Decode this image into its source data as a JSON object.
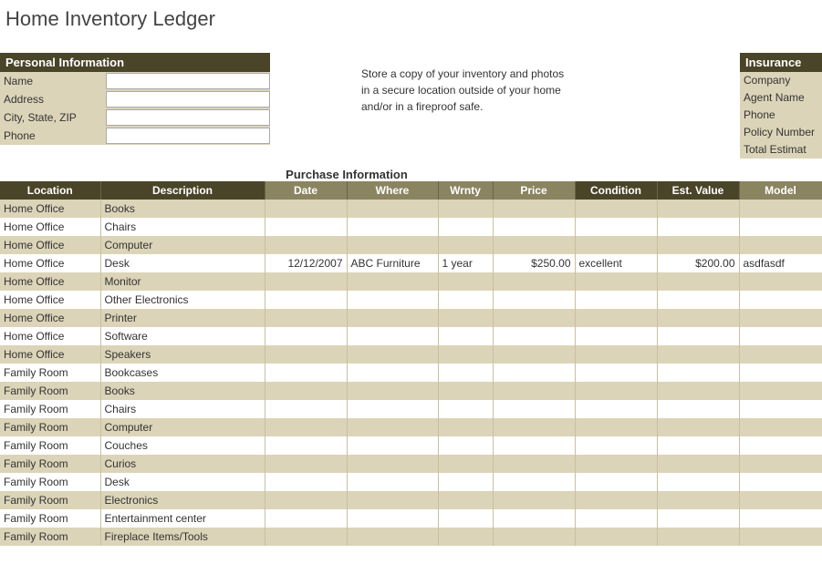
{
  "title": "Home Inventory Ledger",
  "personal": {
    "header": "Personal Information",
    "fields": [
      {
        "label": "Name",
        "value": ""
      },
      {
        "label": "Address",
        "value": ""
      },
      {
        "label": "City, State, ZIP",
        "value": ""
      },
      {
        "label": "Phone",
        "value": ""
      }
    ]
  },
  "note": {
    "line1": "Store a copy of your inventory and photos",
    "line2": "in a secure location outside of your home",
    "line3": "and/or in a fireproof safe."
  },
  "insurance": {
    "header": "Insurance",
    "fields": [
      "Company",
      "Agent Name",
      "Phone",
      "Policy Number",
      "Total Estimat"
    ]
  },
  "purchase_section_title": "Purchase Information",
  "columns": {
    "location": "Location",
    "description": "Description",
    "date": "Date",
    "where": "Where",
    "wrnty": "Wrnty",
    "price": "Price",
    "condition": "Condition",
    "est_value": "Est. Value",
    "model": "Model"
  },
  "rows": [
    {
      "location": "Home Office",
      "description": "Books",
      "date": "",
      "where": "",
      "wrnty": "",
      "price": "",
      "condition": "",
      "est_value": "",
      "model": ""
    },
    {
      "location": "Home Office",
      "description": "Chairs",
      "date": "",
      "where": "",
      "wrnty": "",
      "price": "",
      "condition": "",
      "est_value": "",
      "model": ""
    },
    {
      "location": "Home Office",
      "description": "Computer",
      "date": "",
      "where": "",
      "wrnty": "",
      "price": "",
      "condition": "",
      "est_value": "",
      "model": ""
    },
    {
      "location": "Home Office",
      "description": "Desk",
      "date": "12/12/2007",
      "where": "ABC Furniture",
      "wrnty": "1 year",
      "price": "$250.00",
      "condition": "excellent",
      "est_value": "$200.00",
      "model": "asdfasdf"
    },
    {
      "location": "Home Office",
      "description": "Monitor",
      "date": "",
      "where": "",
      "wrnty": "",
      "price": "",
      "condition": "",
      "est_value": "",
      "model": ""
    },
    {
      "location": "Home Office",
      "description": "Other Electronics",
      "date": "",
      "where": "",
      "wrnty": "",
      "price": "",
      "condition": "",
      "est_value": "",
      "model": ""
    },
    {
      "location": "Home Office",
      "description": "Printer",
      "date": "",
      "where": "",
      "wrnty": "",
      "price": "",
      "condition": "",
      "est_value": "",
      "model": ""
    },
    {
      "location": "Home Office",
      "description": "Software",
      "date": "",
      "where": "",
      "wrnty": "",
      "price": "",
      "condition": "",
      "est_value": "",
      "model": ""
    },
    {
      "location": "Home Office",
      "description": "Speakers",
      "date": "",
      "where": "",
      "wrnty": "",
      "price": "",
      "condition": "",
      "est_value": "",
      "model": ""
    },
    {
      "location": "Family Room",
      "description": "Bookcases",
      "date": "",
      "where": "",
      "wrnty": "",
      "price": "",
      "condition": "",
      "est_value": "",
      "model": ""
    },
    {
      "location": "Family Room",
      "description": "Books",
      "date": "",
      "where": "",
      "wrnty": "",
      "price": "",
      "condition": "",
      "est_value": "",
      "model": ""
    },
    {
      "location": "Family Room",
      "description": "Chairs",
      "date": "",
      "where": "",
      "wrnty": "",
      "price": "",
      "condition": "",
      "est_value": "",
      "model": ""
    },
    {
      "location": "Family Room",
      "description": "Computer",
      "date": "",
      "where": "",
      "wrnty": "",
      "price": "",
      "condition": "",
      "est_value": "",
      "model": ""
    },
    {
      "location": "Family Room",
      "description": "Couches",
      "date": "",
      "where": "",
      "wrnty": "",
      "price": "",
      "condition": "",
      "est_value": "",
      "model": ""
    },
    {
      "location": "Family Room",
      "description": "Curios",
      "date": "",
      "where": "",
      "wrnty": "",
      "price": "",
      "condition": "",
      "est_value": "",
      "model": ""
    },
    {
      "location": "Family Room",
      "description": "Desk",
      "date": "",
      "where": "",
      "wrnty": "",
      "price": "",
      "condition": "",
      "est_value": "",
      "model": ""
    },
    {
      "location": "Family Room",
      "description": "Electronics",
      "date": "",
      "where": "",
      "wrnty": "",
      "price": "",
      "condition": "",
      "est_value": "",
      "model": ""
    },
    {
      "location": "Family Room",
      "description": "Entertainment center",
      "date": "",
      "where": "",
      "wrnty": "",
      "price": "",
      "condition": "",
      "est_value": "",
      "model": ""
    },
    {
      "location": "Family Room",
      "description": "Fireplace Items/Tools",
      "date": "",
      "where": "",
      "wrnty": "",
      "price": "",
      "condition": "",
      "est_value": "",
      "model": ""
    }
  ]
}
